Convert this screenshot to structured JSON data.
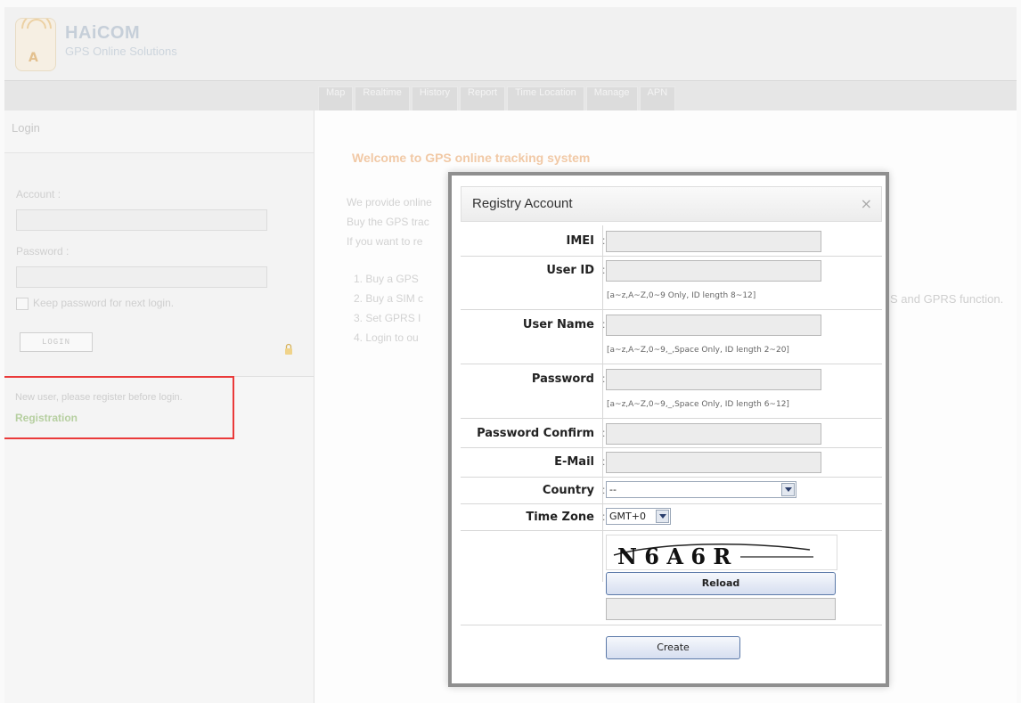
{
  "header": {
    "brand": "HAiCOM",
    "subtitle": "GPS Online Solutions"
  },
  "nav": {
    "tabs": [
      "Map",
      "Realtime",
      "History",
      "Report",
      "Time Location",
      "Manage",
      "APN"
    ]
  },
  "sidebar": {
    "title": "Login",
    "account_label": "Account :",
    "password_label": "Password :",
    "keep_label": "Keep password for next login.",
    "login_button": "LOGIN",
    "register_note": "New user, please register before login.",
    "register_link": "Registration"
  },
  "main": {
    "welcome": "Welcome to GPS online tracking system",
    "lines": [
      "We provide online",
      "Buy the GPS trac",
      "If you want to re"
    ],
    "steps": [
      "1.  Buy a GPS",
      "2.  Buy a SIM c",
      "3.  Set GPRS I",
      "4.  Login to ou"
    ],
    "gprs_tail": "S and GPRS function."
  },
  "modal": {
    "title": "Registry Account",
    "close": "×",
    "fields": {
      "imei": "IMEI",
      "user_id": "User ID",
      "user_id_hint": "[a~z,A~Z,0~9 Only, ID length 8~12]",
      "user_name": "User Name",
      "user_name_hint": "[a~z,A~Z,0~9,_,Space Only, ID length 2~20]",
      "password": "Password",
      "password_hint": "[a~z,A~Z,0~9,_,Space Only, ID length 6~12]",
      "password_confirm": "Password Confirm",
      "email": "E-Mail",
      "country": "Country",
      "country_value": "--",
      "timezone": "Time Zone",
      "timezone_value": "GMT+0"
    },
    "captcha_text": "N 6 A 6 R",
    "reload_button": "Reload",
    "create_button": "Create"
  }
}
